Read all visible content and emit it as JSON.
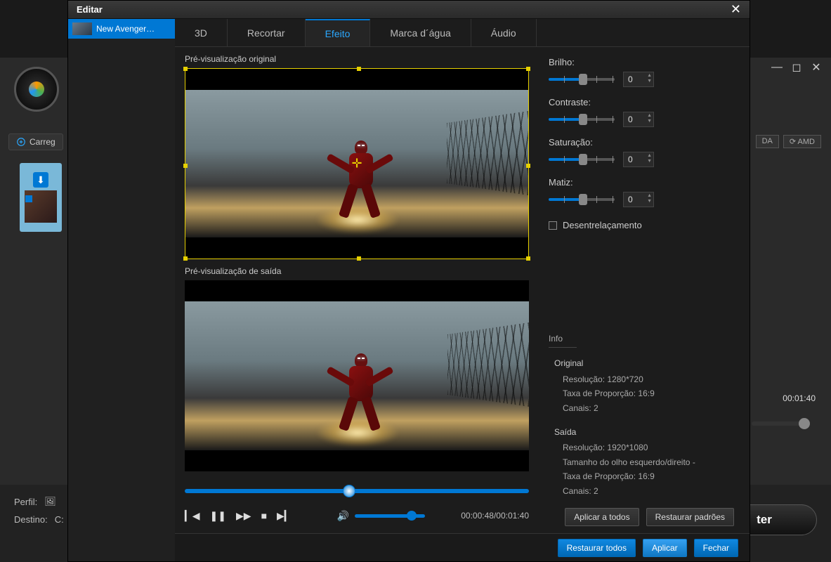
{
  "bg": {
    "minimize": "—",
    "maximize": "◻",
    "close": "✕",
    "load_button": "Carreg",
    "badge_da": "DA",
    "badge_amd": "⟳ AMD",
    "time": "00:01:40",
    "profile_label": "Perfil:",
    "dest_label": "Destino:",
    "dest_value": "C:",
    "convert": "ter"
  },
  "modal": {
    "title": "Editar",
    "close": "✕"
  },
  "sidebar": {
    "items": [
      {
        "label": "New Avenger…"
      }
    ]
  },
  "tabs": [
    {
      "label": "3D",
      "active": false
    },
    {
      "label": "Recortar",
      "active": false
    },
    {
      "label": "Efeito",
      "active": true
    },
    {
      "label": "Marca d´água",
      "active": false
    },
    {
      "label": "Áudio",
      "active": false
    }
  ],
  "preview": {
    "label_original": "Pré-visualização original",
    "label_output": "Pré-visualização de saída",
    "time_current": "00:00:48",
    "time_total": "00:01:40",
    "time_display": "00:00:48/00:01:40"
  },
  "effects": {
    "brightness": {
      "label": "Brilho:",
      "value": "0"
    },
    "contrast": {
      "label": "Contraste:",
      "value": "0"
    },
    "saturation": {
      "label": "Saturação:",
      "value": "0"
    },
    "hue": {
      "label": "Matiz:",
      "value": "0"
    },
    "deinterlace": {
      "label": "Desentrelaçamento",
      "checked": false
    }
  },
  "info": {
    "header": "Info",
    "original": {
      "title": "Original",
      "resolution_label": "Resolução:",
      "resolution": "1280*720",
      "aspect_label": "Taxa de Proporção:",
      "aspect": "16:9",
      "channels_label": "Canais:",
      "channels": "2"
    },
    "output": {
      "title": "Saída",
      "resolution_label": "Resolução:",
      "resolution": "1920*1080",
      "eye_label": "Tamanho do olho esquerdo/direito",
      "eye": "-",
      "aspect_label": "Taxa de Proporção:",
      "aspect": "16:9",
      "channels_label": "Canais:",
      "channels": "2"
    }
  },
  "actions": {
    "apply_all": "Aplicar a todos",
    "restore_defaults": "Restaurar padrões"
  },
  "footer": {
    "restore_all": "Restaurar todos",
    "apply": "Aplicar",
    "close": "Fechar"
  }
}
